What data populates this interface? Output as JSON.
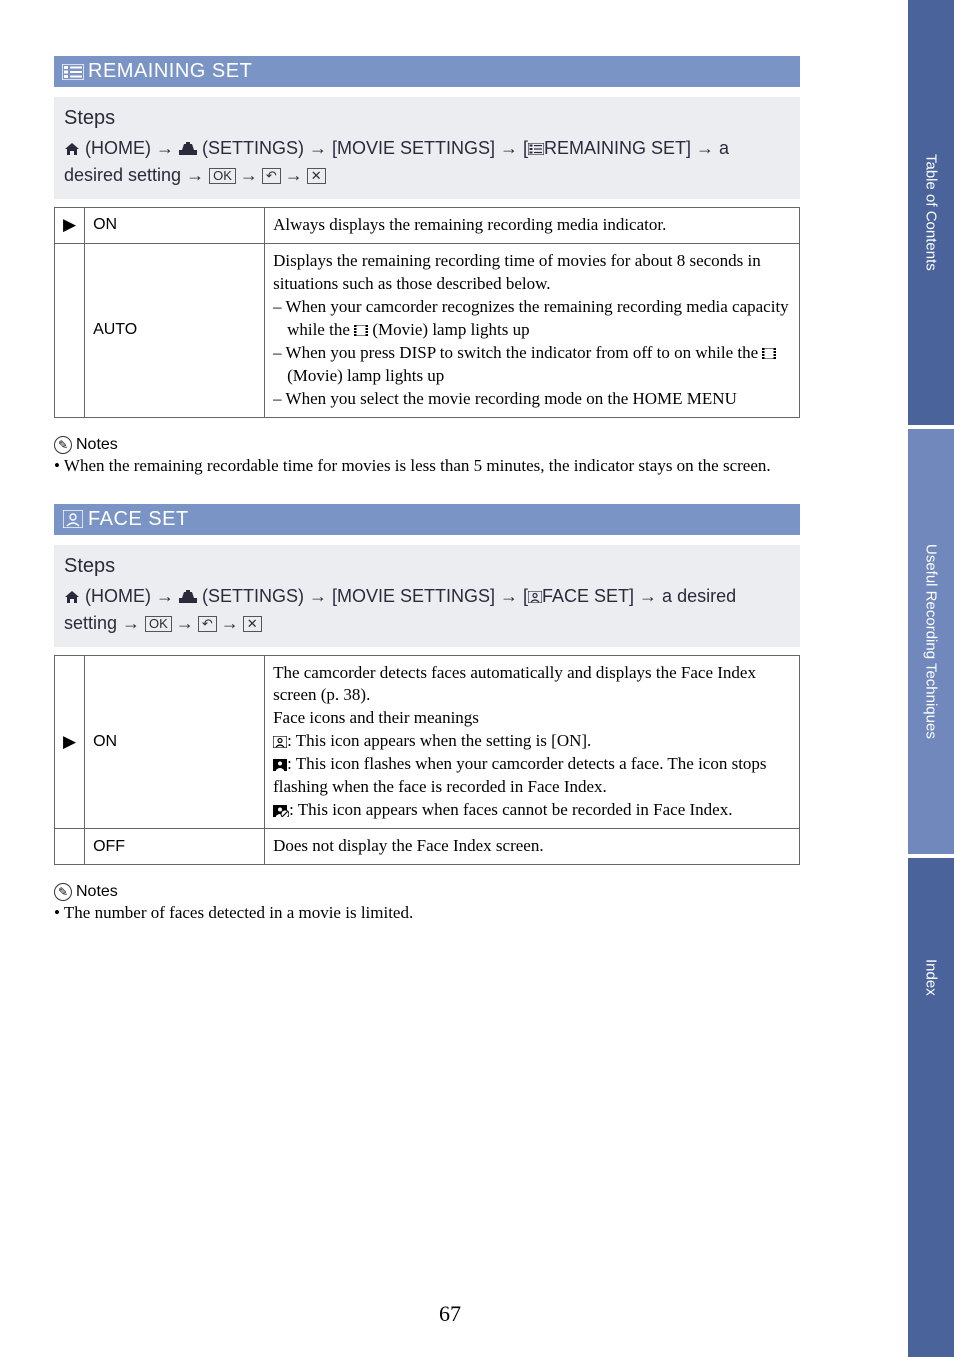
{
  "sidebar": {
    "tab1": "Table of Contents",
    "tab2": "Useful Recording Techniques",
    "tab3": "Index"
  },
  "page_number": "67",
  "remaining_set": {
    "heading": "REMAINING SET",
    "steps_title": "Steps",
    "steps_path_1": " (HOME) → ",
    "steps_path_2": " (SETTINGS) → [MOVIE SETTINGS] → [",
    "steps_path_3": "REMAINING SET] → a desired setting → ",
    "ok_label": "OK",
    "back_label": "↶",
    "close_label": "✕",
    "table": {
      "row1": {
        "mark": "▶",
        "label": "ON",
        "desc": "Always displays the remaining recording media indicator."
      },
      "row2": {
        "mark": "",
        "label": "AUTO",
        "desc_l1": "Displays the remaining recording time of movies for about 8 seconds in situations such as those described below.",
        "desc_l2a": "– When your camcorder recognizes the remaining recording media capacity while the ",
        "desc_l2b": " (Movie) lamp lights up",
        "desc_l3a": "– When you press DISP to switch the indicator from off to on while the ",
        "desc_l3b": " (Movie) lamp lights up",
        "desc_l4": "– When you select the movie recording mode on the HOME MENU"
      }
    },
    "notes_title": "Notes",
    "notes": [
      "When the remaining recordable time for movies is less than 5 minutes, the indicator stays on the screen."
    ]
  },
  "face_set": {
    "heading": "FACE SET",
    "steps_title": "Steps",
    "steps_path_1": " (HOME) → ",
    "steps_path_2": " (SETTINGS) → [MOVIE SETTINGS] → [",
    "steps_path_3": "FACE SET] → a desired setting → ",
    "ok_label": "OK",
    "back_label": "↶",
    "close_label": "✕",
    "table": {
      "row1": {
        "mark": "▶",
        "label": "ON",
        "desc_l1": "The camcorder detects faces automatically and displays the Face Index screen (p. 38).",
        "desc_l2": "Face icons and their meanings",
        "desc_l3": ": This icon appears when the setting is [ON].",
        "desc_l4": ": This icon flashes when your camcorder detects a face. The icon stops flashing when the face is recorded in Face Index.",
        "desc_l5": ": This icon appears when faces cannot be recorded in Face Index."
      },
      "row2": {
        "mark": "",
        "label": "OFF",
        "desc": "Does not display the Face Index screen."
      }
    },
    "notes_title": "Notes",
    "notes": [
      "The number of faces detected in a movie is limited."
    ]
  }
}
